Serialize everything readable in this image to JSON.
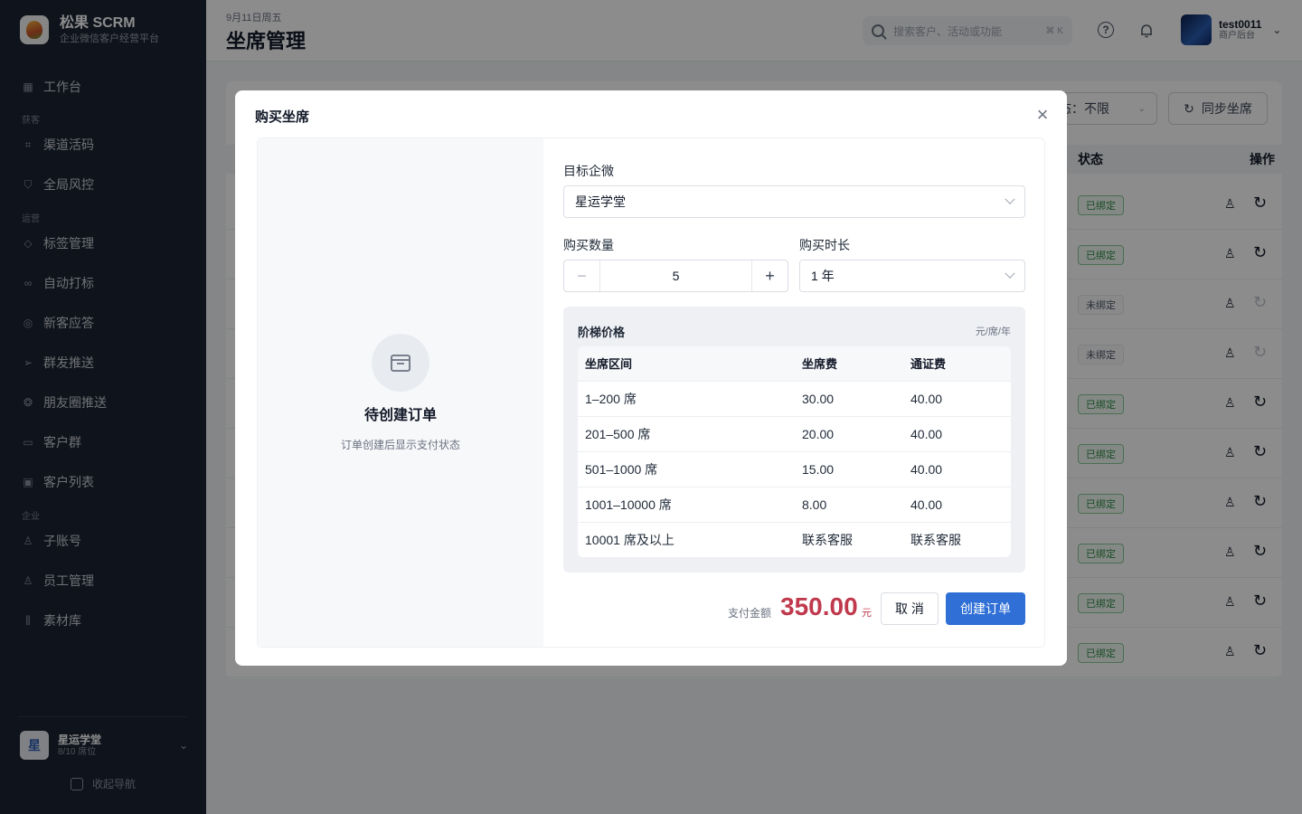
{
  "brand": {
    "name": "松果 SCRM",
    "subtitle": "企业微信客户经营平台"
  },
  "sidebar": {
    "items": [
      {
        "label": "工作台",
        "icon": "grid-icon"
      },
      {
        "group": "获客"
      },
      {
        "label": "渠道活码",
        "icon": "qrcode-scan-icon"
      },
      {
        "label": "全局风控",
        "icon": "shield-icon"
      },
      {
        "group": "运营"
      },
      {
        "label": "标签管理",
        "icon": "tag-icon"
      },
      {
        "label": "自动打标",
        "icon": "link-icon"
      },
      {
        "label": "新客应答",
        "icon": "chat-reply-icon"
      },
      {
        "label": "群发推送",
        "icon": "send-icon"
      },
      {
        "label": "朋友圈推送",
        "icon": "aperture-icon"
      },
      {
        "label": "客户群",
        "icon": "group-chat-icon"
      },
      {
        "label": "客户列表",
        "icon": "contacts-icon"
      },
      {
        "group": "企业"
      },
      {
        "label": "子账号",
        "icon": "user-icon"
      },
      {
        "label": "员工管理",
        "icon": "users-icon"
      },
      {
        "label": "素材库",
        "icon": "library-icon"
      }
    ],
    "org": {
      "avatar": "星",
      "name": "星运学堂",
      "seats": "8/10 席位"
    },
    "collapse_label": "收起导航"
  },
  "header": {
    "date": "9月11日周五",
    "title": "坐席管理",
    "search_placeholder": "搜索客户、活动或功能",
    "search_shortcut": "⌘ K",
    "user": {
      "name": "test0011",
      "role": "商户后台"
    }
  },
  "background": {
    "status_filter": "态：不限",
    "sync_button": "同步坐席",
    "columns": {
      "status": "状态",
      "ops": "操作"
    },
    "rows": [
      {
        "status": "已绑定",
        "bound": true
      },
      {
        "status": "已绑定",
        "bound": true
      },
      {
        "status": "未绑定",
        "bound": false
      },
      {
        "status": "未绑定",
        "bound": false
      },
      {
        "status": "已绑定",
        "bound": true
      },
      {
        "status": "已绑定",
        "bound": true
      },
      {
        "status": "已绑定",
        "bound": true
      },
      {
        "status": "已绑定",
        "bound": true
      },
      {
        "status": "已绑定",
        "bound": true
      },
      {
        "status": "已绑定",
        "bound": true
      }
    ]
  },
  "modal": {
    "title": "购买坐席",
    "empty": {
      "title": "待创建订单",
      "desc": "订单创建后显示支付状态"
    },
    "target_label": "目标企微",
    "target_value": "星运学堂",
    "qty_label": "购买数量",
    "qty_value": "5",
    "duration_label": "购买时长",
    "duration_value": "1 年",
    "tier": {
      "title": "阶梯价格",
      "unit": "元/席/年",
      "headers": [
        "坐席区间",
        "坐席费",
        "通证费"
      ],
      "rows": [
        [
          "1–200 席",
          "30.00",
          "40.00"
        ],
        [
          "201–500 席",
          "20.00",
          "40.00"
        ],
        [
          "501–1000 席",
          "15.00",
          "40.00"
        ],
        [
          "1001–10000 席",
          "8.00",
          "40.00"
        ],
        [
          "10001 席及以上",
          "联系客服",
          "联系客服"
        ]
      ]
    },
    "pay_label": "支付金额",
    "pay_amount": "350.00",
    "pay_unit": "元",
    "cancel_label": "取 消",
    "create_label": "创建订单"
  },
  "colors": {
    "accent": "#2f6fd6",
    "price": "#c0394d",
    "sidebar_bg": "#1c2433",
    "bound": "#2f8a46"
  }
}
